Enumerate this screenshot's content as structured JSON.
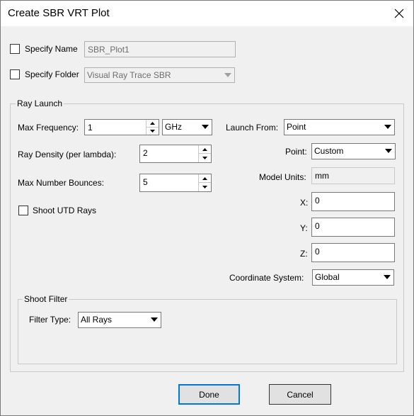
{
  "window": {
    "title": "Create SBR VRT Plot"
  },
  "specify_name": {
    "label": "Specify Name",
    "checked": false,
    "value": "SBR_Plot1"
  },
  "specify_folder": {
    "label": "Specify Folder",
    "checked": false,
    "value": "Visual Ray Trace SBR"
  },
  "ray_launch": {
    "title": "Ray Launch",
    "max_frequency": {
      "label": "Max Frequency:",
      "value": "1",
      "unit": "GHz"
    },
    "ray_density": {
      "label": "Ray Density (per lambda):",
      "value": "2"
    },
    "max_bounces": {
      "label": "Max Number Bounces:",
      "value": "5"
    },
    "shoot_utd": {
      "label": "Shoot UTD Rays",
      "checked": false
    },
    "launch_from": {
      "label": "Launch From:",
      "value": "Point"
    },
    "point": {
      "label": "Point:",
      "value": "Custom"
    },
    "model_units": {
      "label": "Model Units:",
      "value": "mm"
    },
    "x": {
      "label": "X:",
      "value": "0"
    },
    "y": {
      "label": "Y:",
      "value": "0"
    },
    "z": {
      "label": "Z:",
      "value": "0"
    },
    "coordinate_system": {
      "label": "Coordinate System:",
      "value": "Global"
    }
  },
  "shoot_filter": {
    "title": "Shoot Filter",
    "filter_type": {
      "label": "Filter Type:",
      "value": "All Rays"
    }
  },
  "buttons": {
    "done": "Done",
    "cancel": "Cancel"
  },
  "icons": {
    "close": "close-icon",
    "dropdown": "chevron-down-icon",
    "spin_up": "spin-up-icon",
    "spin_down": "spin-down-icon"
  },
  "colors": {
    "accent": "#0078d7",
    "window_bg": "#f0f0f0",
    "titlebar_bg": "#ffffff"
  }
}
